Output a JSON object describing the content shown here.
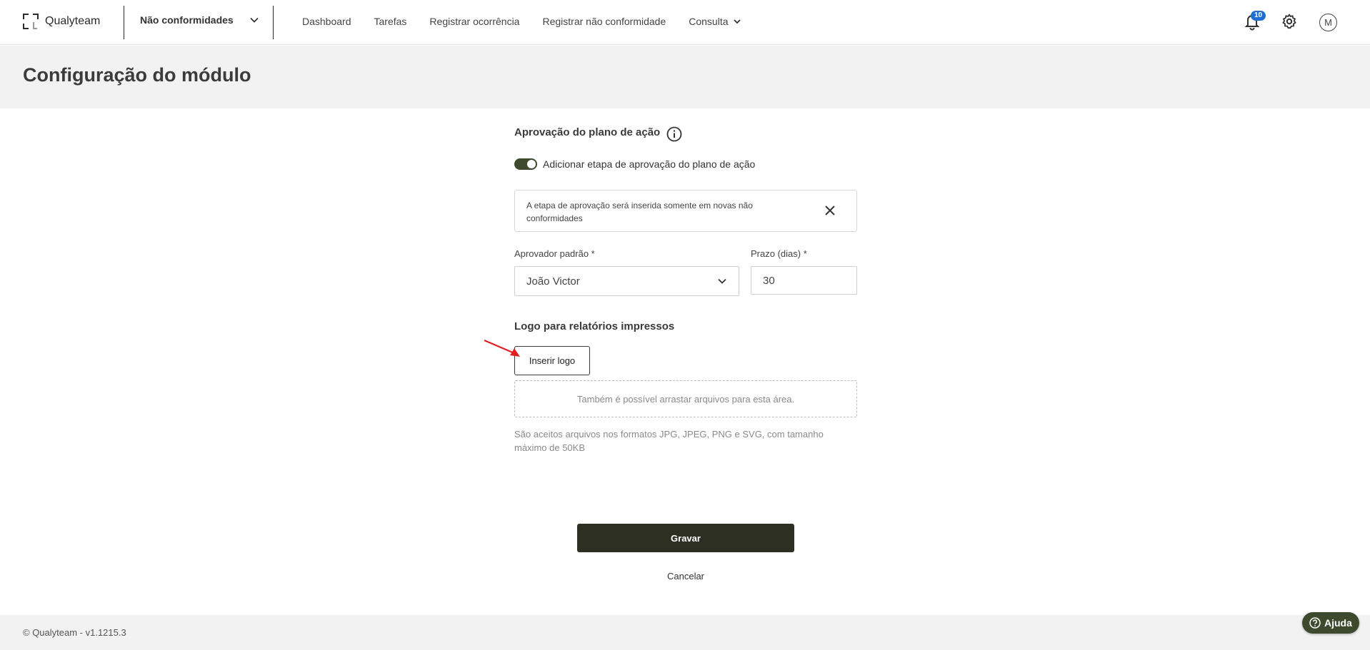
{
  "brand": {
    "name": "Qualyteam"
  },
  "header": {
    "module": "Não conformidades",
    "nav": [
      {
        "label": "Dashboard"
      },
      {
        "label": "Tarefas"
      },
      {
        "label": "Registrar ocorrência"
      },
      {
        "label": "Registrar não conformidade"
      },
      {
        "label": "Consulta"
      }
    ],
    "notifications_count": "10",
    "avatar_initial": "M"
  },
  "page": {
    "title": "Configuração do módulo"
  },
  "approval": {
    "section_title": "Aprovação do plano de ação",
    "toggle_label": "Adicionar etapa de aprovação do plano de ação",
    "toggle_on": true,
    "notice": "A etapa de aprovação será inserida somente em novas não conformidades",
    "approver_label": "Aprovador padrão *",
    "approver_value": "João Victor",
    "deadline_label": "Prazo (dias) *",
    "deadline_value": "30"
  },
  "logo_section": {
    "title": "Logo para relatórios impressos",
    "insert_button": "Inserir logo",
    "dropzone_text": "Também é possível arrastar arquivos para esta área.",
    "hint": "São aceitos arquivos nos formatos JPG, JPEG, PNG e SVG, com tamanho máximo de 50KB"
  },
  "actions": {
    "save": "Gravar",
    "cancel": "Cancelar"
  },
  "footer": {
    "text": "© Qualyteam - v1.1215.3",
    "help": "Ajuda"
  },
  "colors": {
    "primary": "#2d2f22",
    "toggle": "#3d4a2e",
    "badge": "#1f6fd1",
    "arrow": "#e02020"
  }
}
